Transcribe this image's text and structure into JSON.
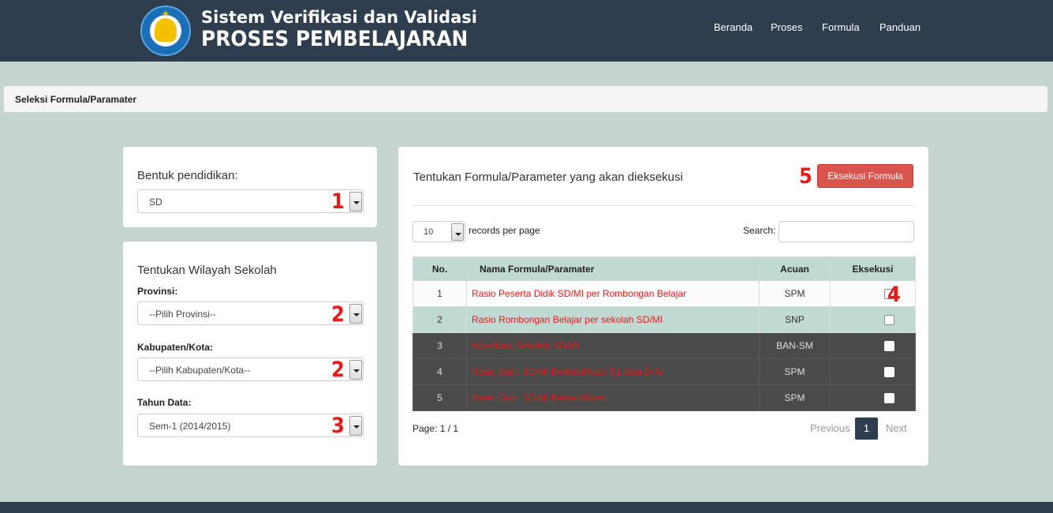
{
  "header": {
    "title_line1": "Sistem Verifikasi dan Validasi",
    "title_line2": "PROSES PEMBELAJARAN",
    "nav": [
      "Beranda",
      "Proses",
      "Formula",
      "Panduan"
    ]
  },
  "breadcrumb": "Seleksi Formula/Paramater",
  "left": {
    "bentuk_label": "Bentuk pendidikan:",
    "bentuk_value": "SD",
    "wilayah_title": "Tentukan Wilayah Sekolah",
    "provinsi_label": "Provinsi:",
    "provinsi_value": "--Pilih Provinsi--",
    "kabupaten_label": "Kabupaten/Kota:",
    "kabupaten_value": "--Pilih Kabupaten/Kota--",
    "tahun_label": "Tahun Data:",
    "tahun_value": "Sem-1 (2014/2015)"
  },
  "annotations": [
    "1",
    "2",
    "2",
    "3",
    "4",
    "5"
  ],
  "right": {
    "title": "Tentukan Formula/Parameter yang akan dieksekusi",
    "exec_button": "Eksekusi Formula",
    "records_value": "10",
    "records_label": "records per page",
    "search_label": "Search:",
    "columns": [
      "No.",
      "Nama Formula/Paramater",
      "Acuan",
      "Eksekusi"
    ],
    "rows": [
      {
        "no": "1",
        "name": "Rasio Peserta Didik SD/MI per Rombongan Belajar",
        "acuan": "SPM"
      },
      {
        "no": "2",
        "name": "Rasio Rombongan Belajar per sekolah SD/MI",
        "acuan": "SNP"
      },
      {
        "no": "3",
        "name": "Akreditasi Sekolah SD/MI",
        "acuan": "BAN-SM"
      },
      {
        "no": "4",
        "name": "Rasio Guru SD/MI Berkualifikasi S1 atau D-IV",
        "acuan": "SPM"
      },
      {
        "no": "5",
        "name": "Rasio Guru SD/MI Bersertifikasi",
        "acuan": "SPM"
      }
    ],
    "page_info": "Page: 1 / 1",
    "prev": "Previous",
    "current_page": "1",
    "next": "Next"
  },
  "colors": {
    "header": "#2e3e4f",
    "accent_red": "#d9534f",
    "annotation": "#e31b1b",
    "table_head": "#c1d9d3"
  }
}
